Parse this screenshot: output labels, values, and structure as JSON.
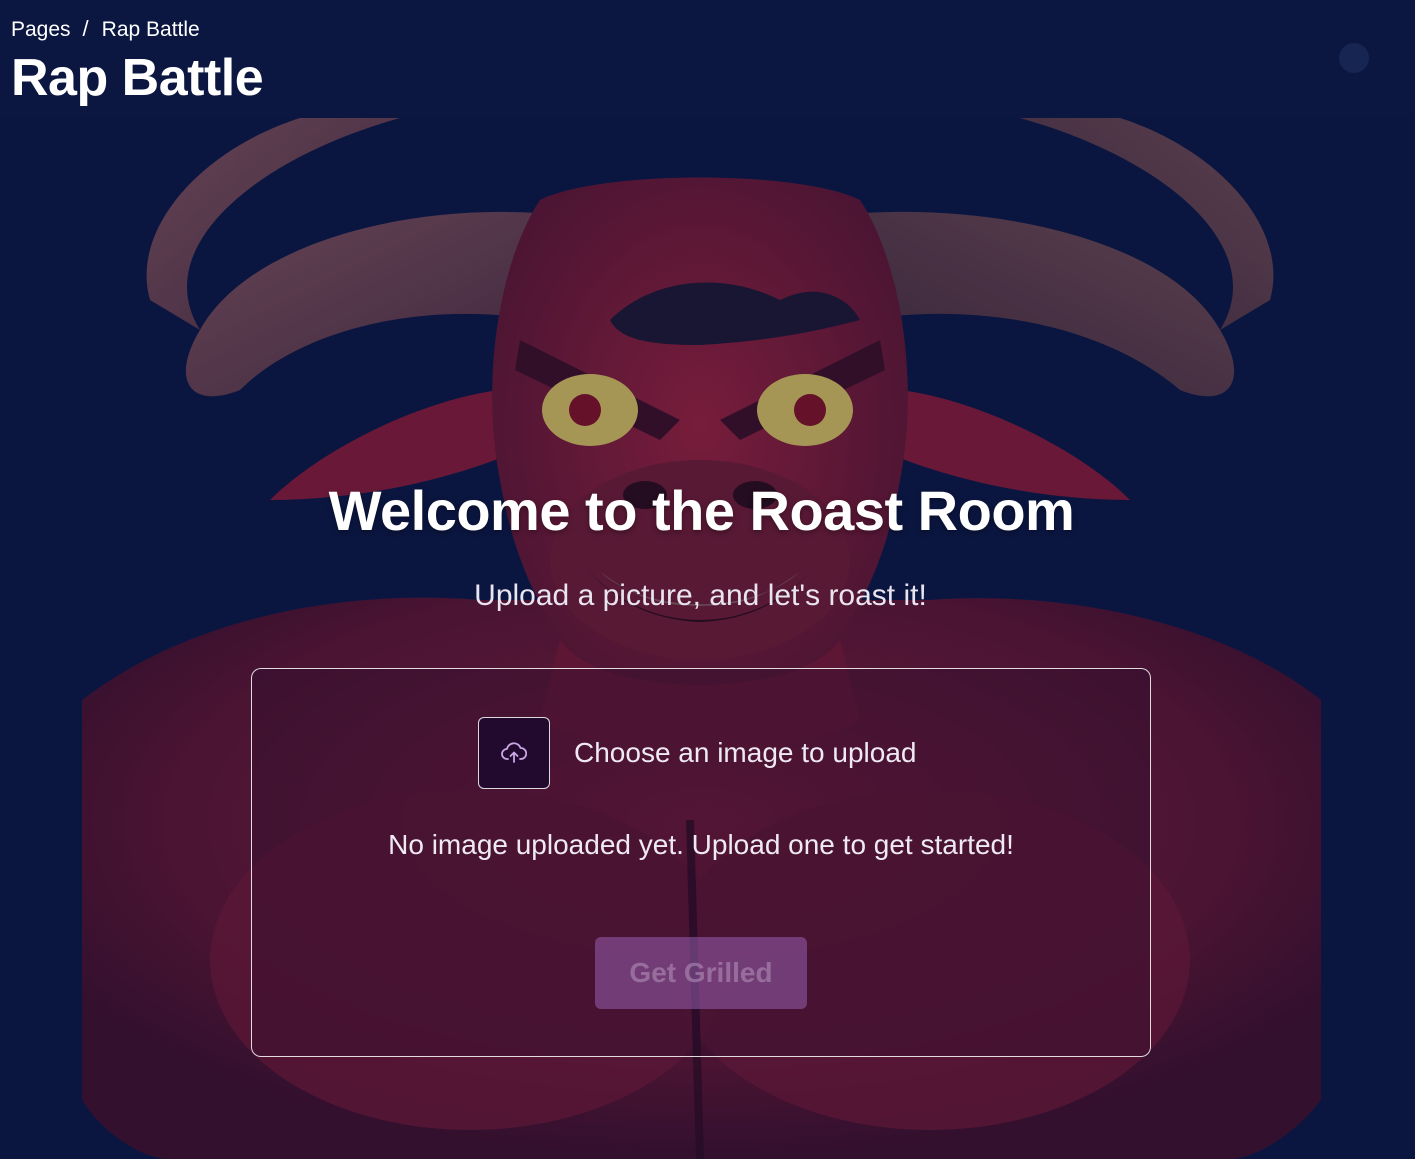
{
  "header": {
    "breadcrumb": [
      "Pages",
      "Rap Battle"
    ],
    "breadcrumb_separator": "/",
    "title": "Rap Battle"
  },
  "hero": {
    "heading": "Welcome to the Roast Room",
    "subtitle": "Upload a picture, and let's roast it!",
    "image": "angry-red-bull-mascot"
  },
  "upload": {
    "icon": "cloud-upload-icon",
    "label": "Choose an image to upload",
    "status": "No image uploaded yet. Upload one to get started!",
    "submit_label": "Get Grilled",
    "submit_disabled": true
  },
  "colors": {
    "background": "#0b1740",
    "accent": "#a56fc4",
    "bull_red": "#8a1c33"
  }
}
